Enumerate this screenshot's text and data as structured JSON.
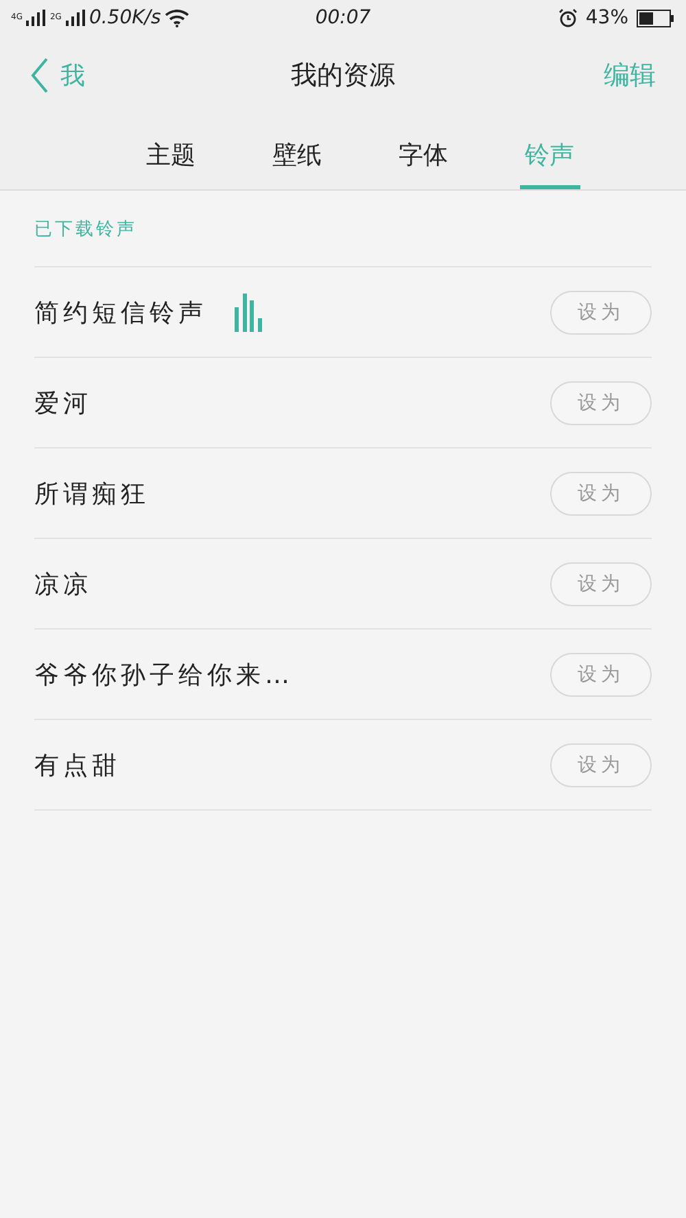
{
  "status_bar": {
    "sim_labels": [
      "4G",
      "2G"
    ],
    "speed": "0.50K/s",
    "time": "00:07",
    "battery": "43%"
  },
  "nav": {
    "back": "我",
    "title": "我的资源",
    "action": "编辑"
  },
  "tabs": [
    {
      "label": "主题",
      "selected": false
    },
    {
      "label": "壁纸",
      "selected": false
    },
    {
      "label": "字体",
      "selected": false
    },
    {
      "label": "铃声",
      "selected": true
    }
  ],
  "section": "已下载铃声",
  "ringtones": [
    {
      "name": "简约短信铃声",
      "playing": true,
      "button": "设为"
    },
    {
      "name": "爱河",
      "playing": false,
      "button": "设为"
    },
    {
      "name": "所谓痴狂",
      "playing": false,
      "button": "设为"
    },
    {
      "name": "凉凉",
      "playing": false,
      "button": "设为"
    },
    {
      "name": "爷爷你孙子给你来…",
      "playing": false,
      "button": "设为"
    },
    {
      "name": "有点甜",
      "playing": false,
      "button": "设为"
    }
  ]
}
